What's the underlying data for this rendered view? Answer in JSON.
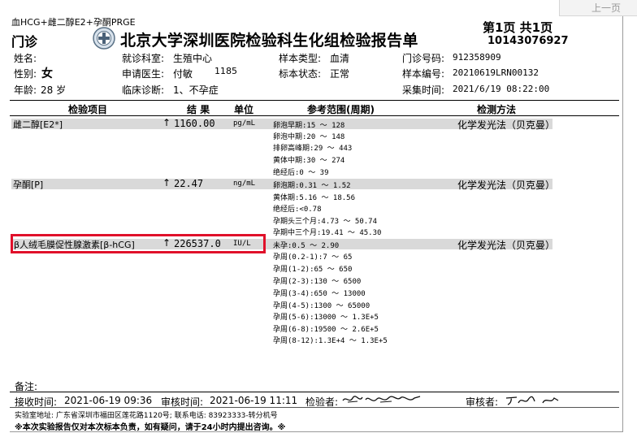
{
  "nav": {
    "prev_page": "上一页"
  },
  "header": {
    "test_group": "血HCG+雌二醇E2+孕酮PRGE",
    "dept": "门诊",
    "title": "北京大学深圳医院检验科生化组检验报告单",
    "page_label": "第1页 共1页",
    "report_no": "10143076927"
  },
  "patient": {
    "name_label": "姓名:",
    "sex_label": "性别:",
    "sex_value": "女",
    "age_label": "年龄:",
    "age_value": "28 岁",
    "dept_label": "就诊科室:",
    "dept_value": "生殖中心",
    "doctor_label": "申请医生:",
    "doctor_value": "付敏",
    "doctor_code": "1185",
    "diagnosis_label": "临床诊断:",
    "diagnosis_value": "1、不孕症",
    "sample_type_label": "样本类型:",
    "sample_type_value": "血清",
    "sample_status_label": "标本状态:",
    "sample_status_value": "正常",
    "clinic_no_label": "门诊号码:",
    "clinic_no_value": "912358909",
    "sample_no_label": "样本编号:",
    "sample_no_value": "20210619LRN00132",
    "collect_time_label": "采集时间:",
    "collect_time_value": "2021/6/19 08:22:00"
  },
  "columns": {
    "item": "检验项目",
    "result": "结 果",
    "unit": "单位",
    "reference": "参考范围(周期)",
    "method": "检测方法"
  },
  "results": [
    {
      "name": "雌二醇[E2*]",
      "flag": "↑",
      "value": "1160.00",
      "unit": "pg/mL",
      "method": "化学发光法（贝克曼）",
      "ranges": [
        "卵泡早期:15 ～ 128",
        "卵泡中期:20 ～ 148",
        "排卵高峰期:29 ～ 443",
        "黄体中期:30 ～ 274",
        "绝经后:0 ～ 39"
      ]
    },
    {
      "name": "孕酮[P]",
      "flag": "↑",
      "value": "22.47",
      "unit": "ng/mL",
      "method": "化学发光法（贝克曼）",
      "ranges": [
        "卵泡期:0.31 ～ 1.52",
        "黄体期:5.16 ～ 18.56",
        "绝经后:<0.78",
        "孕期头三个月:4.73 ～ 50.74",
        "孕期中三个月:19.41 ～ 45.30"
      ]
    },
    {
      "name": "β人绒毛膜促性腺激素[β-hCG]",
      "flag": "↑",
      "value": "226537.0",
      "unit": "IU/L",
      "method": "化学发光法（贝克曼）",
      "ranges": [
        "未孕:0.5 ～ 2.90",
        "孕周(0.2-1):7 ～ 65",
        "孕周(1-2):65 ～ 650",
        "孕周(2-3):130 ～ 6500",
        "孕周(3-4):650 ～ 13000",
        "孕周(4-5):1300 ～ 65000",
        "孕周(5-6):13000 ～ 1.3E+5",
        "孕周(6-8):19500 ～ 2.6E+5",
        "孕周(8-12):1.3E+4 ～ 1.3E+5"
      ]
    }
  ],
  "footer": {
    "remark_label": "备注:",
    "receive_label": "接收时间:",
    "receive_value": "2021-06-19 09:36",
    "review_time_label": "审核时间:",
    "review_time_value": "2021-06-19 11:11",
    "tester_label": "检验者:",
    "reviewer_label": "审核者:",
    "address": "实验室地址: 广东省深圳市福田区莲花路1120号; 联系电话: 83923333-转分机号",
    "notice": "※本次实验报告仅对本次标本负责，如有疑问，请于24小时内提出咨询。※"
  }
}
